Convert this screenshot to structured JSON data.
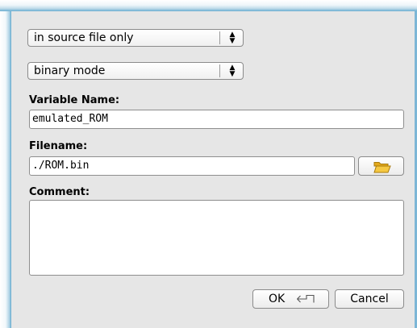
{
  "scope_select": {
    "value": "in source file only"
  },
  "mode_select": {
    "value": "binary mode"
  },
  "variable_name": {
    "label": "Variable Name:",
    "value": "emulated_ROM"
  },
  "filename": {
    "label": "Filename:",
    "value": "./ROM.bin"
  },
  "comment": {
    "label": "Comment:",
    "value": ""
  },
  "buttons": {
    "ok": "OK",
    "cancel": "Cancel"
  },
  "icons": {
    "select_arrows": "up-down-arrows-icon",
    "browse": "folder-icon",
    "ok_enter": "enter-key-icon"
  },
  "colors": {
    "folder": "#f5c842",
    "window_border": "#6aaed1",
    "dialog_bg": "#e6e6e6"
  }
}
